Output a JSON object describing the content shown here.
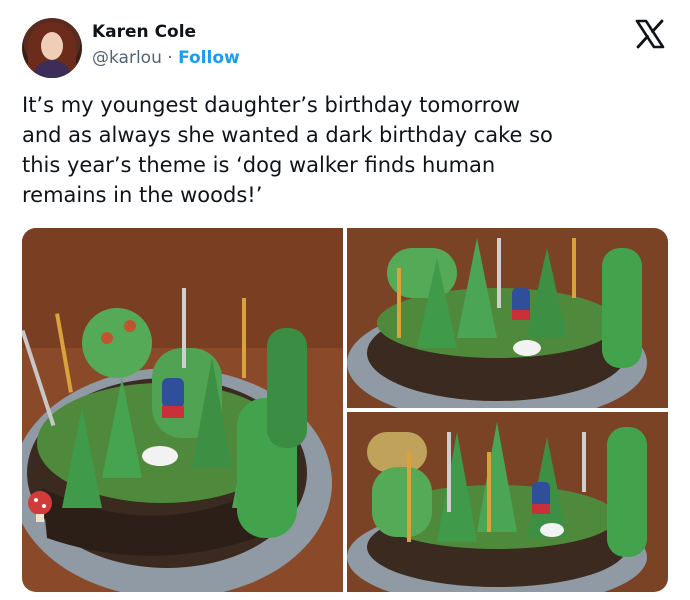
{
  "author": {
    "name": "Karen Cole",
    "handle": "@karlou",
    "separator": "·",
    "follow_label": "Follow"
  },
  "icons": {
    "platform": "x-logo-icon"
  },
  "tweet": {
    "text": "It’s my youngest daughter’s birthday tomorrow\nand as always she wanted a dark birthday cake so\nthis year’s theme is ‘dog walker finds human\nremains in the woods!’"
  },
  "colors": {
    "follow": "#1d9bf0",
    "handle": "#536471",
    "text": "#0f1419"
  }
}
